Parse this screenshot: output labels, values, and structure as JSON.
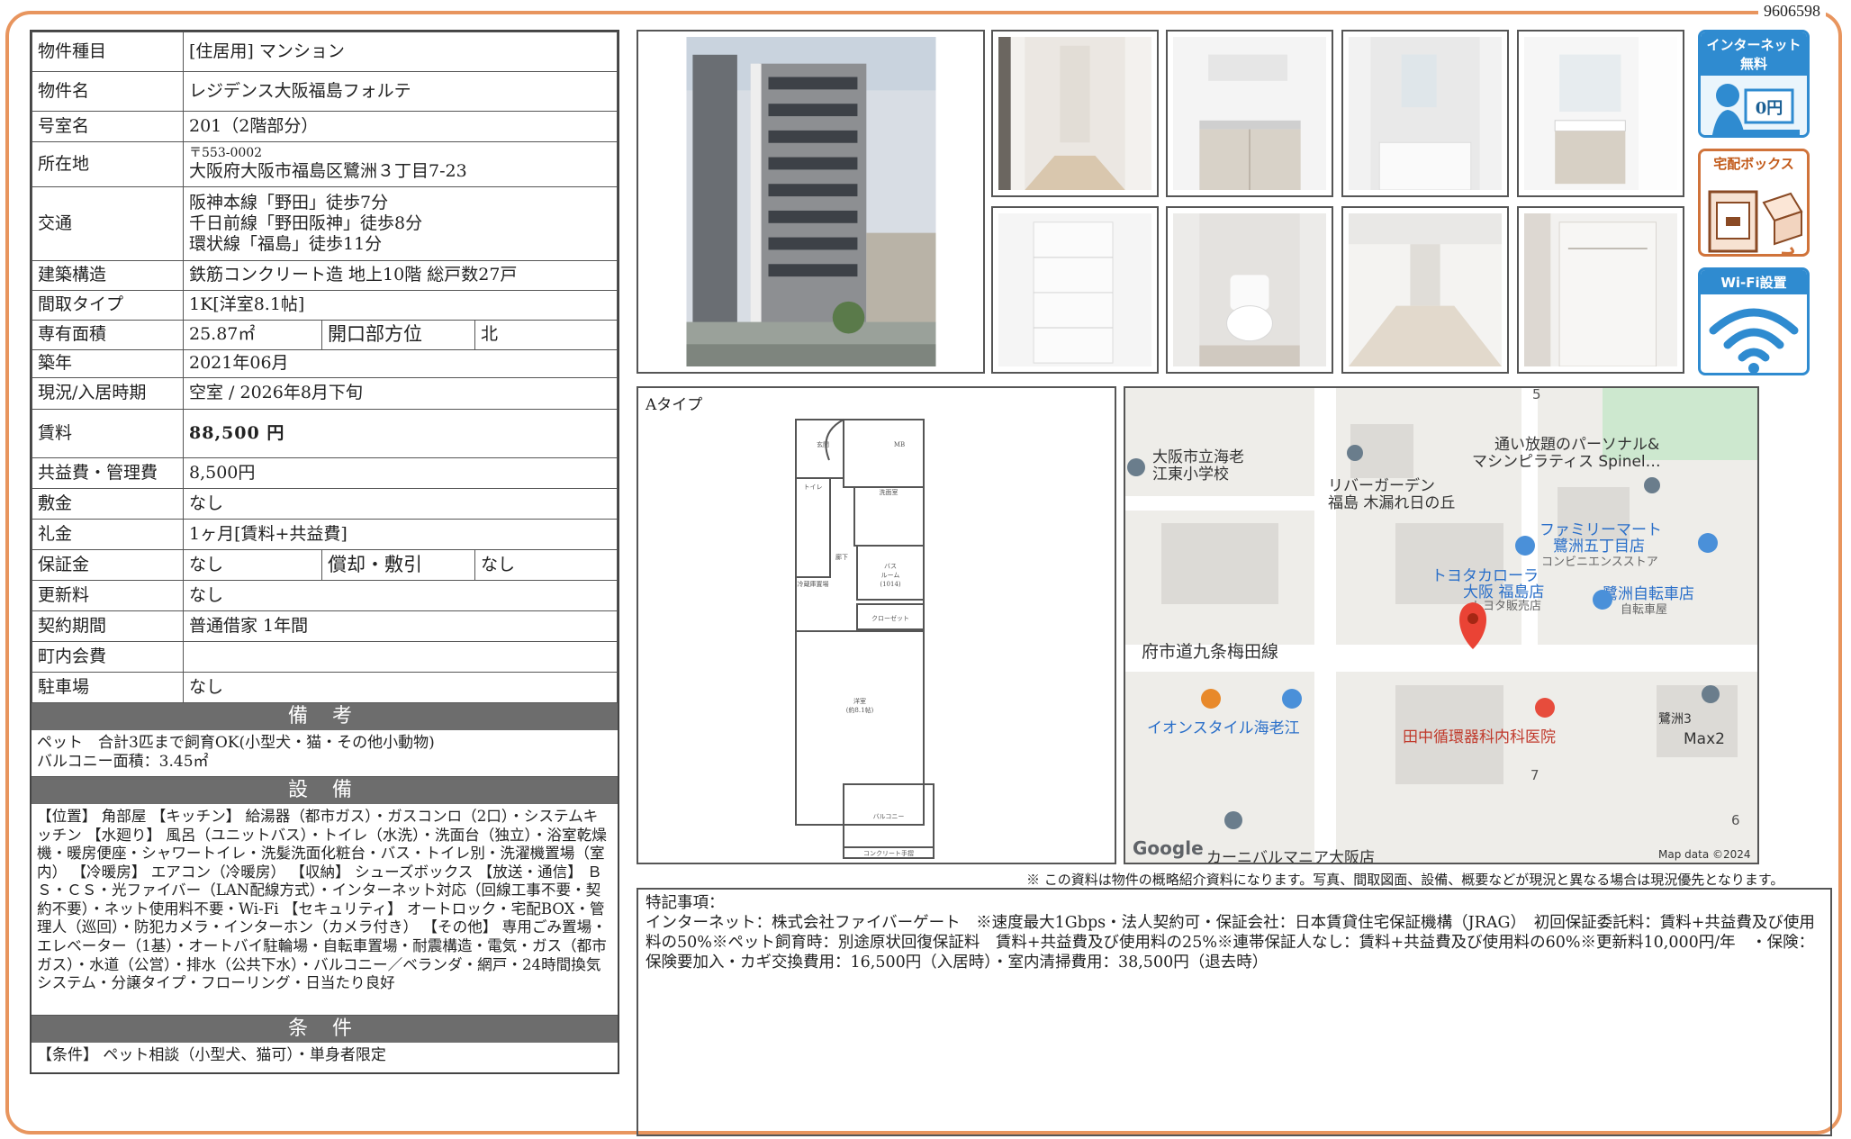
{
  "doc_id": "9606598",
  "spec": {
    "property_type": {
      "label": "物件種目",
      "value": "[住居用]  マンション"
    },
    "property_name": {
      "label": "物件名",
      "value": "レジデンス大阪福島フォルテ"
    },
    "room": {
      "label": "号室名",
      "value": "201（2階部分）"
    },
    "address": {
      "label": "所在地",
      "postal": "〒553-0002",
      "value": "大阪府大阪市福島区鷺洲３丁目7-23"
    },
    "traffic": {
      "label": "交通",
      "lines": [
        "阪神本線「野田」徒歩7分",
        "千日前線「野田阪神」徒歩8分",
        "環状線「福島」徒歩11分"
      ]
    },
    "structure": {
      "label": "建築構造",
      "value": "鉄筋コンクリート造 地上10階 総戸数27戸"
    },
    "layout": {
      "label": "間取タイプ",
      "value": "1K[洋室8.1帖]"
    },
    "area": {
      "label": "専有面積",
      "value": "25.87㎡",
      "dir_label": "開口部方位",
      "dir_value": "北"
    },
    "built": {
      "label": "築年",
      "value": "2021年06月"
    },
    "status": {
      "label": "現況/入居時期",
      "value": "空室  /  2026年8月下旬"
    },
    "rent": {
      "label": "賃料",
      "value": "88,500 円"
    },
    "common_fee": {
      "label": "共益費・管理費",
      "value": "8,500円"
    },
    "deposit": {
      "label": "敷金",
      "value": "なし"
    },
    "key_money": {
      "label": "礼金",
      "value": "1ヶ月[賃料+共益費]"
    },
    "guarantee": {
      "label": "保証金",
      "value": "なし",
      "amort_label": "償却・敷引",
      "amort_value": "なし"
    },
    "renewal": {
      "label": "更新料",
      "value": "なし"
    },
    "contract": {
      "label": "契約期間",
      "value": "普通借家 1年間"
    },
    "community_fee": {
      "label": "町内会費",
      "value": ""
    },
    "parking": {
      "label": "駐車場",
      "value": "なし"
    }
  },
  "bikou": {
    "title": "備 考",
    "text": "ペット　合計3匹まで飼育OK(小型犬・猫・その他小動物)\nバルコニー面積：3.45㎡"
  },
  "setsubi": {
    "title": "設 備",
    "text": "【位置】 角部屋 【キッチン】 給湯器（都市ガス）・ガスコンロ（2口）・システムキッチン 【水廻り】 風呂（ユニットバス）・トイレ（水洗）・洗面台（独立）・浴室乾燥機・暖房便座・シャワートイレ・洗髪洗面化粧台・バス・トイレ別・洗濯機置場（室内） 【冷暖房】 エアコン（冷暖房） 【収納】 シューズボックス 【放送・通信】 ＢＳ・ＣＳ・光ファイバー（LAN配線方式）・インターネット対応（回線工事不要・契約不要）・ネット使用料不要・Wi-Fi 【セキュリティ】 オートロック・宅配BOX・管理人（巡回）・防犯カメラ・インターホン（カメラ付き） 【その他】 専用ごみ置場・エレベーター（1基）・オートバイ駐輪場・自転車置場・耐震構造・電気・ガス（都市ガス）・水道（公営）・排水（公共下水）・バルコニー／ベランダ・網戸・24時間換気システム・分譲タイプ・フローリング・日当たり良好"
  },
  "jouken": {
    "title": "条 件",
    "text": "【条件】 ペット相談（小型犬、猫可）・単身者限定"
  },
  "badges": {
    "internet": "インターネット無料",
    "internet_price": "0円",
    "delivery": "宅配ボックス",
    "wifi": "Wi-Fi設置"
  },
  "floorplan": {
    "type_label": "Aタイプ",
    "rooms": {
      "genkan": "玄関",
      "mb": "MB",
      "toilet": "トイレ",
      "senmen": "洗面室",
      "bath": "バス",
      "bath_size": "ルーム",
      "bath_dim": "(1014)",
      "rouka": "廊下",
      "closet": "クローゼット",
      "youshitsu": "洋室",
      "youshitsu_size": "(約8.1帖)",
      "balcony": "バルコニー",
      "reizouko": "冷蔵庫置場",
      "concrete": "コンクリート手摺"
    }
  },
  "map": {
    "labels": {
      "school": "大阪市立海老江東小学校",
      "school_l1": "大阪市立海老",
      "school_l2": "江東小学校",
      "riverside_l1": "リバーガーデン",
      "riverside_l2": "福島 木漏れ日の丘",
      "pilates_l1": "通い放題のパーソナル&",
      "pilates_l2": "マシンピラティス Spinel…",
      "familymart": "ファミリーマート",
      "familymart_l2": "鷺洲五丁目店",
      "familymart_l3": "コンビニエンスストア",
      "toyota_l1": "トヨタカローラ",
      "toyota_l2": "大阪 福島店",
      "toyota_l3": "トヨタ販売店",
      "bicycle_l1": "鷺洲自転車店",
      "bicycle_l2": "自転車屋",
      "road": "府道九条梅田線",
      "road_display": "府市道九条梅田線",
      "aeon": "イオンスタイル海老江",
      "clinic": "田中循環器科内科医院",
      "sagisu3": "鷺洲3",
      "max2": "Max2",
      "carnival": "カーニバルマニア大阪店",
      "google": "Google",
      "mapdata": "Map data ©2024",
      "num5": "5",
      "num7": "7",
      "num6": "6"
    }
  },
  "disclaimer": "※ この資料は物件の概略紹介資料になります。写真、間取図面、設備、概要などが現況と異なる場合は現況優先となります。",
  "remarks": {
    "title": "特記事項：",
    "text": "インターネット：株式会社ファイバーゲート　※速度最大1Gbps・法人契約可・保証会社：日本賃貸住宅保証機構（JRAG）　初回保証委託料：賃料+共益費及び使用料の50%※ペット飼育時：別途原状回復保証料　賃料+共益費及び使用料の25%※連帯保証人なし：賃料+共益費及び使用料の60%※更新料10,000円/年　・保険：保険要加入・カギ交換費用：16,500円（入居時）・室内清掃費用：38,500円（退去時）"
  }
}
